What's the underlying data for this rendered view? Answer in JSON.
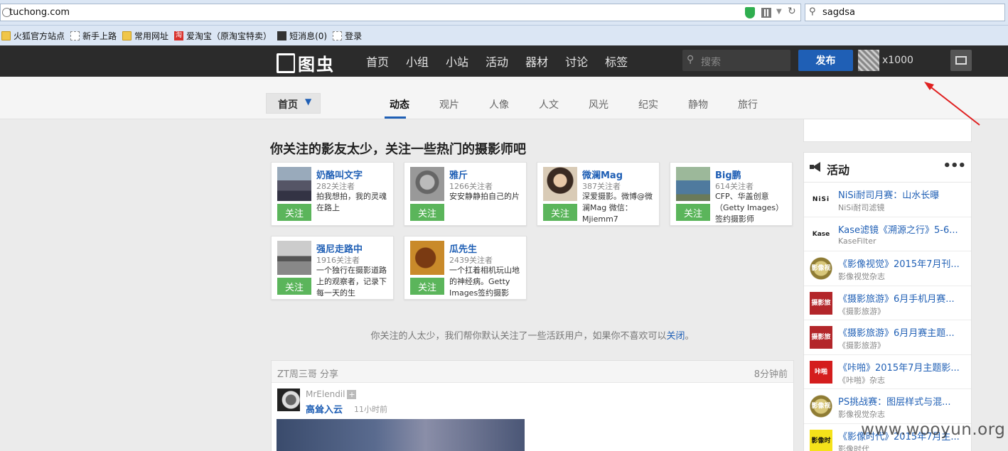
{
  "browser": {
    "url": "tuchong.com",
    "search_text": "sagdsa",
    "bookmarks": [
      {
        "label": "火狐官方站点",
        "icon": "folder-icon"
      },
      {
        "label": "新手上路",
        "icon": "page-icon"
      },
      {
        "label": "常用网址",
        "icon": "folder-icon"
      },
      {
        "label": "爱淘宝（原淘宝特卖）",
        "icon": "taobao-icon"
      },
      {
        "label": "短消息(0)",
        "icon": "message-icon"
      },
      {
        "label": "登录",
        "icon": "page-icon"
      }
    ]
  },
  "nav": {
    "logo_text": "图虫",
    "links": [
      "首页",
      "小组",
      "小站",
      "活动",
      "器材",
      "讨论",
      "标签"
    ],
    "search_placeholder": "搜索",
    "publish_label": "发布",
    "username": "x1000"
  },
  "subnav": {
    "home_label": "首页",
    "tabs": [
      "动态",
      "观片",
      "人像",
      "人文",
      "风光",
      "纪实",
      "静物",
      "旅行"
    ],
    "active_tab": "动态"
  },
  "main": {
    "title": "你关注的影友太少，关注一些热门的摄影师吧",
    "follow_label": "关注",
    "photographers": [
      {
        "name": "奶酪叫文字",
        "followers": "282关注者",
        "bio": "拍我想拍，我的灵魂在路上"
      },
      {
        "name": "雅斤",
        "followers": "1266关注者",
        "bio": "安安静静拍自己的片"
      },
      {
        "name": "微澜Mag",
        "followers": "387关注者",
        "bio": "深爱摄影。微博@微澜Mag 微信：Mjiemm7"
      },
      {
        "name": "Big鹏",
        "followers": "614关注者",
        "bio": "CFP、华盖创意（Getty Images）签约摄影师"
      },
      {
        "name": "强尼走路中",
        "followers": "1916关注者",
        "bio": "一个独行在摄影道路上的观察者，记录下每一天的生"
      },
      {
        "name": "瓜先生",
        "followers": "2439关注者",
        "bio": "一个扛着相机玩山地的神经病。Getty Images签约摄影"
      }
    ],
    "note_text": "你关注的人太少，我们帮你默认关注了一些活跃用户，如果你不喜欢可以",
    "note_link": "关闭",
    "note_end": "。",
    "feed": {
      "header_left": "ZT周三哥 分享",
      "header_right": "8分钟前",
      "user": "MrElendil",
      "plus": "+",
      "title": "高耸入云",
      "time": "11小时前"
    }
  },
  "sidebar": {
    "title": "活动",
    "more": "•••",
    "activities": [
      {
        "title": "NiSi耐司月赛：山水长曝",
        "sub": "NiSi耐司滤镜",
        "logo": "NiSi",
        "logo_class": "logo-nisi"
      },
      {
        "title": "Kase滤镜《溯源之行》5-6...",
        "sub": "KaseFilter",
        "logo": "Kase",
        "logo_class": "logo-kase"
      },
      {
        "title": "《影像视觉》2015年7月刊...",
        "sub": "影像视觉杂志",
        "logo": "影像视觉",
        "logo_class": "logo-gold"
      },
      {
        "title": "《摄影旅游》6月手机月赛...",
        "sub": "《摄影旅游》",
        "logo": "摄影旅游",
        "logo_class": "logo-red"
      },
      {
        "title": "《摄影旅游》6月月赛主题...",
        "sub": "《摄影旅游》",
        "logo": "摄影旅游",
        "logo_class": "logo-red"
      },
      {
        "title": "《咔啪》2015年7月主题影...",
        "sub": "《咔啪》杂志",
        "logo": "咔啪",
        "logo_class": "logo-red2"
      },
      {
        "title": "PS挑战赛：图层样式与混...",
        "sub": "影像视觉杂志",
        "logo": "影像视觉",
        "logo_class": "logo-gold"
      },
      {
        "title": "《影像时代》2015年7月主...",
        "sub": "影像时代",
        "logo": "影像时代",
        "logo_class": "logo-yellow"
      }
    ]
  },
  "watermark": "www.wooyun.org"
}
